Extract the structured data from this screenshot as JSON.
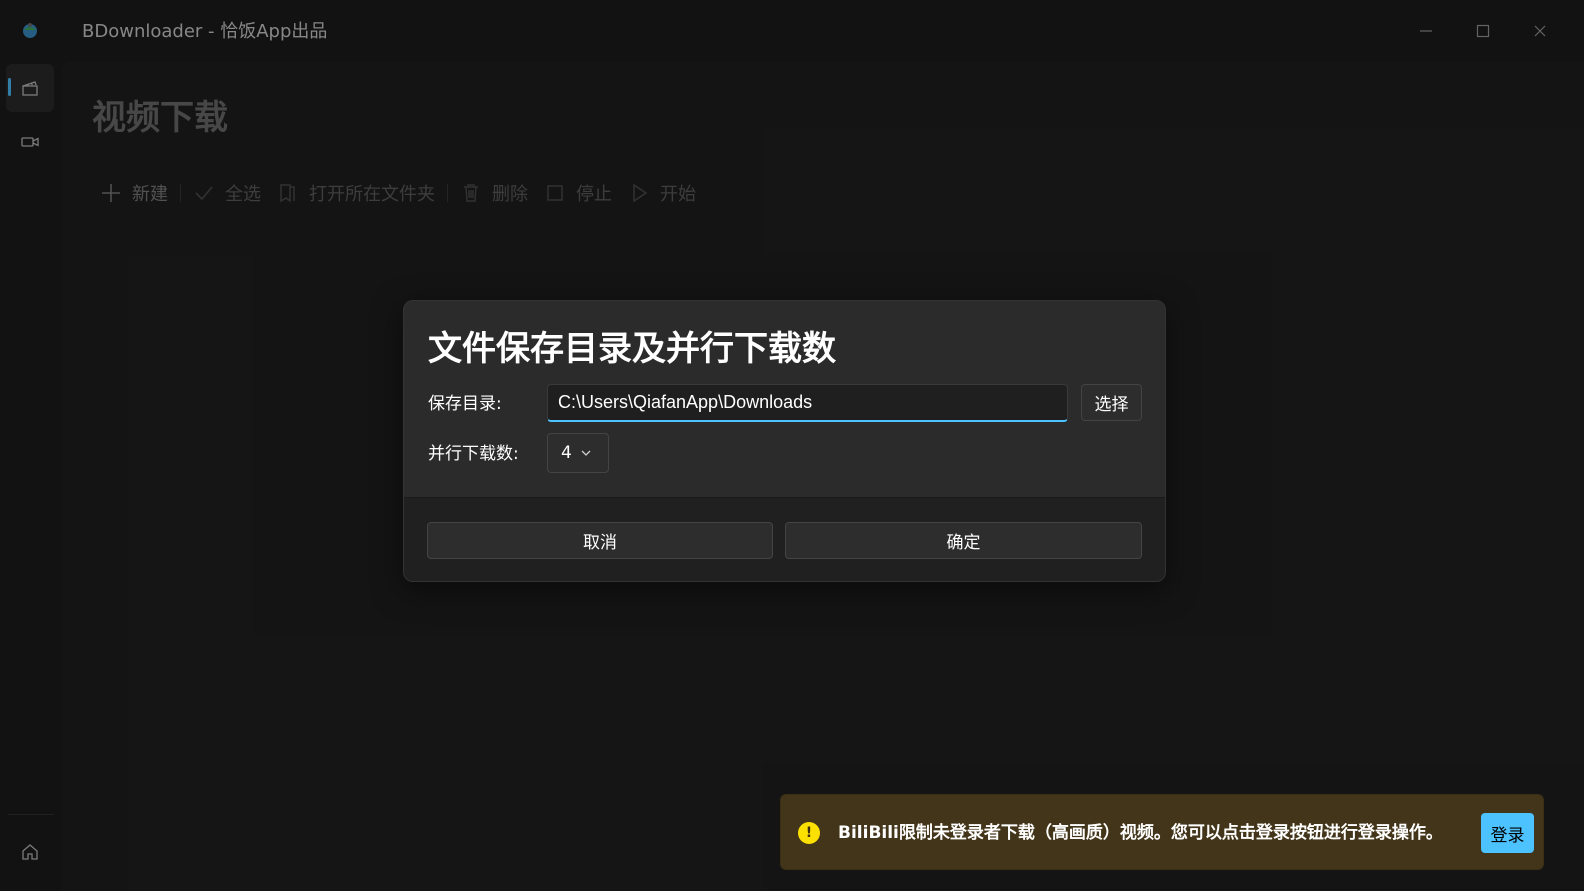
{
  "window": {
    "title": "BDownloader - 恰饭App出品",
    "icon": "app-logo-icon",
    "controls": [
      "minimize-icon",
      "maximize-icon",
      "close-icon"
    ]
  },
  "sidebar": {
    "items": [
      {
        "name": "video-download",
        "icon": "clapperboard-icon",
        "active": true
      },
      {
        "name": "video",
        "icon": "video-camera-icon",
        "active": false
      }
    ],
    "footer_icon": "home-icon"
  },
  "page": {
    "title": "视频下载",
    "toolbar": {
      "new_label": "新建",
      "select_all_label": "全选",
      "open_folder_label": "打开所在文件夹",
      "delete_label": "删除",
      "stop_label": "停止",
      "start_label": "开始"
    }
  },
  "dialog": {
    "title": "文件保存目录及并行下载数",
    "save_dir_label": "保存目录:",
    "save_dir_value": "C:\\Users\\QiafanApp\\Downloads",
    "choose_label": "选择",
    "parallel_label": "并行下载数:",
    "parallel_value": "4",
    "cancel_label": "取消",
    "confirm_label": "确定"
  },
  "infobar": {
    "message": "BiliBili限制未登录者下载（高画质）视频。您可以点击登录按钮进行登录操作。",
    "icon": "warning-icon",
    "login_label": "登录",
    "colors": {
      "background": "#433519",
      "icon": "#fce100",
      "button": "#4cc2ff"
    }
  },
  "colors": {
    "accent": "#4cc2ff",
    "window_bg": "#1c1c1c",
    "dialog_bg": "#2b2b2b"
  }
}
